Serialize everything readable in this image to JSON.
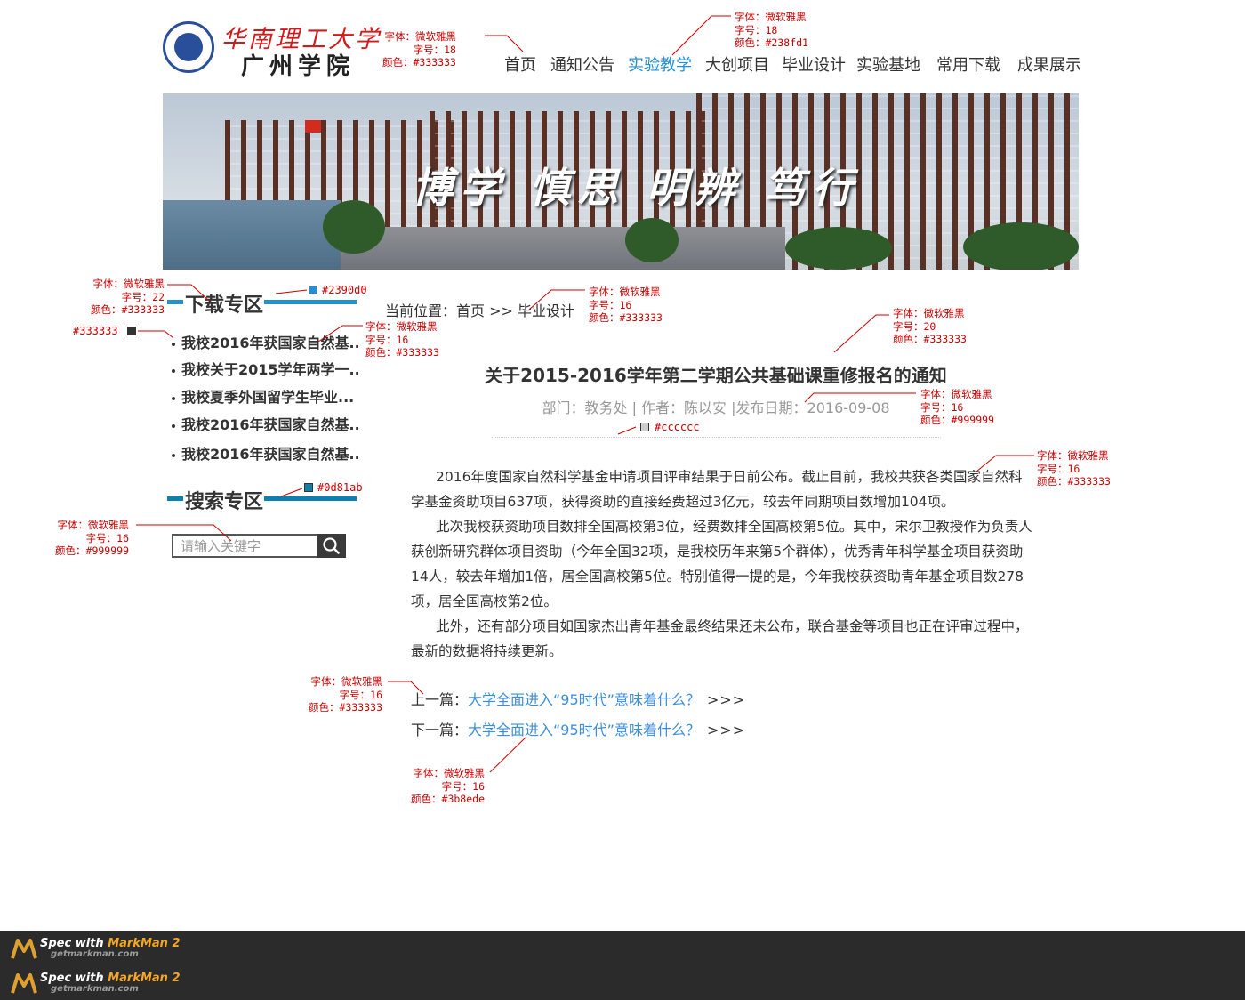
{
  "logo": {
    "name_cn": "华南理工大学",
    "sub_name": "广州学院"
  },
  "nav": {
    "items": [
      {
        "label": "首页"
      },
      {
        "label": "通知公告"
      },
      {
        "label": "实验教学",
        "active": true
      },
      {
        "label": "大创项目"
      },
      {
        "label": "毕业设计"
      },
      {
        "label": "实验基地"
      },
      {
        "label": "常用下载"
      },
      {
        "label": "成果展示"
      }
    ],
    "active_color": "#238fd1",
    "text_color": "#333333"
  },
  "banner": {
    "motto": "博学 慎思 明辨 笃行"
  },
  "sidebar": {
    "download": {
      "title": "下载专区",
      "accent_color": "#2390d0",
      "items": [
        {
          "label": "我校2016年获国家自然基..."
        },
        {
          "label": "我校关于2015学年两学一..."
        },
        {
          "label": "我校夏季外国留学生毕业..."
        },
        {
          "label": "我校2016年获国家自然基..."
        },
        {
          "label": "我校2016年获国家自然基..."
        }
      ]
    },
    "search": {
      "title": "搜索专区",
      "accent_color": "#0d81ab",
      "placeholder": "请输入关键字"
    }
  },
  "breadcrumb": {
    "prefix": "当前位置：",
    "home": "首页",
    "separator": ">>",
    "current": "毕业设计"
  },
  "article": {
    "title": "关于2015-2016学年第二学期公共基础课重修报名的通知",
    "meta": {
      "department": "部门：教务处",
      "author": "作者：陈以安",
      "date": "发布日期：2016-09-08",
      "sep": "|"
    },
    "paragraphs": [
      "2016年度国家自然科学基金申请项目评审结果于日前公布。截止目前，我校共获各类国家自然科学基金资助项目637项，获得资助的直接经费超过3亿元，较去年同期项目数增加104项。",
      "此次我校获资助项目数排全国高校第3位，经费数排全国高校第5位。其中，宋尔卫教授作为负责人获创新研究群体项目资助（今年全国32项，是我校历年来第5个群体），优秀青年科学基金项目获资助14人，较去年增加1倍，居全国高校第5位。特别值得一提的是，今年我校获资助青年基金项目数278项，居全国高校第2位。",
      "此外，还有部分项目如国家杰出青年基金最终结果还未公布，联合基金等项目也正在评审过程中，最新的数据将持续更新。"
    ],
    "prev": {
      "label": "上一篇：",
      "link": "大学全面进入“95时代”意味着什么？",
      "arrow": ">>>"
    },
    "next": {
      "label": "下一篇：",
      "link": "大学全面进入“95时代”意味着什么？",
      "arrow": ">>>"
    },
    "link_color": "#3b8ede",
    "divider_color": "#cccccc"
  },
  "annotations": {
    "nav_normal": [
      "字体：微软雅黑",
      "字号：18",
      "颜色：#333333"
    ],
    "nav_active": [
      "字体：微软雅黑",
      "字号：18",
      "颜色：#238fd1"
    ],
    "download_title": [
      "字体：微软雅黑",
      "字号：22",
      "颜色：#333333"
    ],
    "download_bar": "#2390d0",
    "bullet_color": "#333333",
    "download_item": [
      "字体：微软雅黑",
      "字号：16",
      "颜色：#333333"
    ],
    "breadcrumb": [
      "字体：微软雅黑",
      "字号：16",
      "颜色：#333333"
    ],
    "title": [
      "字体：微软雅黑",
      "字号：20",
      "颜色：#333333"
    ],
    "meta": [
      "字体：微软雅黑",
      "字号：16",
      "颜色：#999999"
    ],
    "divider": "#cccccc",
    "body": [
      "字体：微软雅黑",
      "字号：16",
      "颜色：#333333"
    ],
    "search_bar": "#0d81ab",
    "search_placeholder": [
      "字体：微软雅黑",
      "字号：16",
      "颜色：#999999"
    ],
    "prevnext_label": [
      "字体：微软雅黑",
      "字号：16",
      "颜色：#333333"
    ],
    "prevnext_link": [
      "字体：微软雅黑",
      "字号：16",
      "颜色：#3b8ede"
    ]
  },
  "footer": {
    "badge_title_prefix": "Spec with ",
    "badge_title_brand": "MarkMan 2",
    "badge_url": "getmarkman.com"
  }
}
